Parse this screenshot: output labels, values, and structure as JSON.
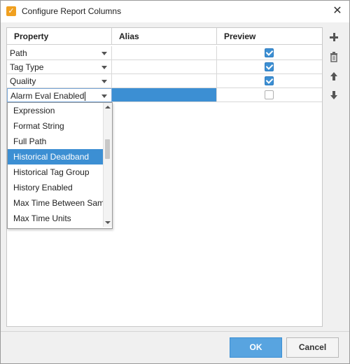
{
  "window": {
    "title": "Configure Report Columns",
    "close_glyph": "✕"
  },
  "table": {
    "headers": [
      "Property",
      "Alias",
      "Preview"
    ],
    "rows": [
      {
        "property": "Path",
        "alias": "",
        "preview": true
      },
      {
        "property": "Tag Type",
        "alias": "",
        "preview": true
      },
      {
        "property": "Quality",
        "alias": "",
        "preview": true
      },
      {
        "property": "Alarm Eval Enabled",
        "alias": "",
        "preview": false
      }
    ]
  },
  "dropdown": {
    "items": [
      "Expression",
      "Format String",
      "Full Path",
      "Historical Deadband",
      "Historical Tag Group",
      "History Enabled",
      "Max Time Between Samples",
      "Max Time Units"
    ],
    "highlighted_index": 3
  },
  "side_toolbar": {
    "icons": [
      "add-icon",
      "delete-icon",
      "move-up-icon",
      "move-down-icon"
    ]
  },
  "footer": {
    "ok_label": "OK",
    "cancel_label": "Cancel"
  },
  "colors": {
    "accent": "#3c8fd3",
    "ok_button": "#58a4e0",
    "app_icon": "#f0a020"
  }
}
